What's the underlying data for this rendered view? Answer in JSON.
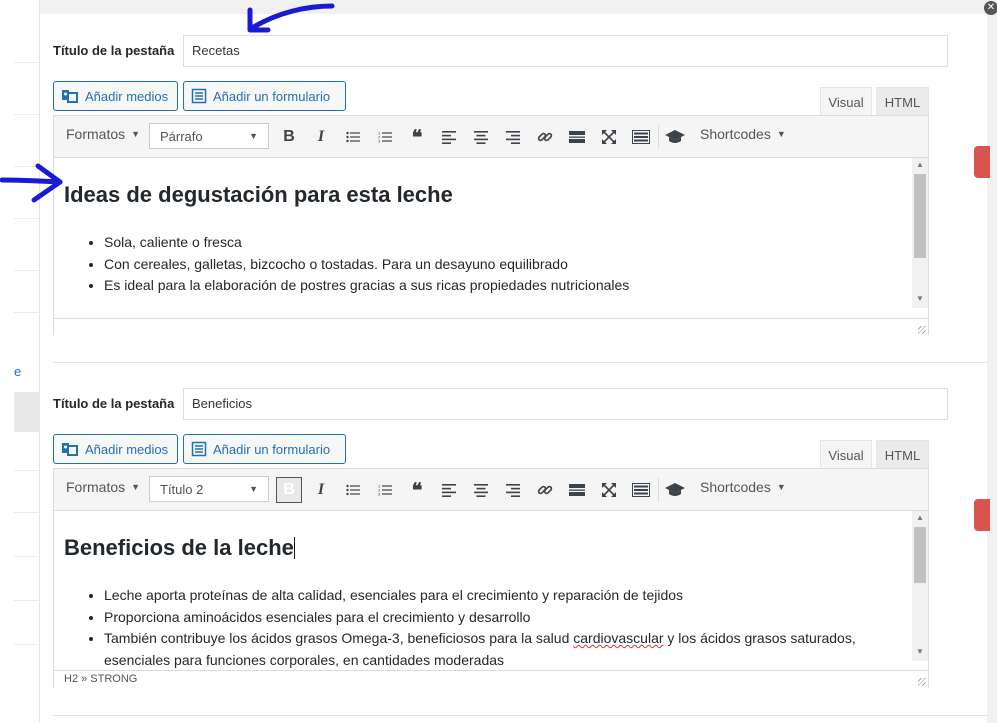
{
  "close_icon_glyph": "✕",
  "sidebar": {
    "partial_text": "e"
  },
  "tabs": [
    {
      "title_label": "Título de la pestaña",
      "title_value": "Recetas",
      "add_media_label": "Añadir medios",
      "add_form_label": "Añadir un formulario",
      "mode_visual": "Visual",
      "mode_html": "HTML",
      "active_mode": "Visual",
      "toolbar": {
        "formats_label": "Formatos",
        "block_format": "Párrafo",
        "shortcodes_label": "Shortcodes",
        "bold": "B",
        "italic": "I",
        "blockquote": "❝"
      },
      "heading": "Ideas de degustación para esta leche",
      "bullets": [
        "Sola, caliente o fresca",
        "Con cereales, galletas, bizcocho o tostadas. Para un desayuno equilibrado",
        "Es ideal para la elaboración de postres gracias a sus ricas propiedades nutricionales"
      ],
      "status_path": ""
    },
    {
      "title_label": "Título de la pestaña",
      "title_value": "Beneficios",
      "add_media_label": "Añadir medios",
      "add_form_label": "Añadir un formulario",
      "mode_visual": "Visual",
      "mode_html": "HTML",
      "active_mode": "Visual",
      "toolbar": {
        "formats_label": "Formatos",
        "block_format": "Título 2",
        "shortcodes_label": "Shortcodes",
        "bold": "B",
        "italic": "I",
        "blockquote": "❝"
      },
      "heading": "Beneficios de la leche",
      "bullets": [
        "Leche aporta proteínas de alta calidad, esenciales para el crecimiento y reparación de tejidos",
        "Proporciona aminoácidos esenciales para el crecimiento y desarrollo"
      ],
      "bullet3_before": "También contribuye los ácidos grasos Omega-3, beneficiosos para la salud ",
      "bullet3_misspelled": "cardiovascular",
      "bullet3_after": " y los ácidos grasos saturados, esenciales para funciones corporales, en cantidades moderadas",
      "status_path": "H2 » STRONG"
    }
  ],
  "colors": {
    "accent": "#2271b1",
    "annotation": "#1a1ad6",
    "red_tab": "#d9534f"
  }
}
